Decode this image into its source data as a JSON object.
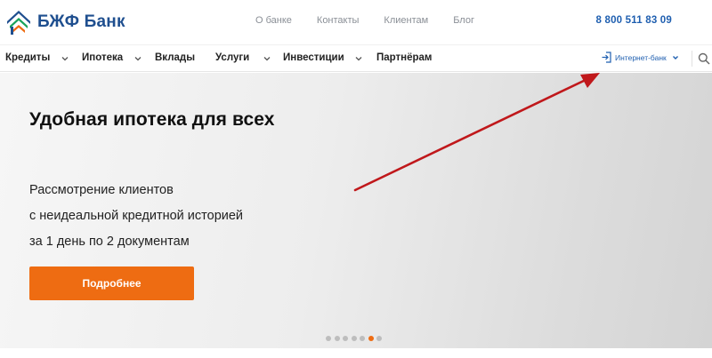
{
  "header": {
    "logo_text": "БЖФ Банк",
    "links": [
      "О банке",
      "Контакты",
      "Клиентам",
      "Блог"
    ],
    "phone": "8 800 511 83 09"
  },
  "nav": {
    "items": [
      "Кредиты",
      "Ипотека",
      "Вклады",
      "Услуги",
      "Инвестиции",
      "Партнёрам"
    ],
    "internet_bank": "Интернет-банк"
  },
  "hero": {
    "title": "Удобная ипотека для всех",
    "subtitle_lines": [
      "Рассмотрение клиентов",
      "с неидеальной кредитной историей",
      "за 1 день по 2 документам"
    ],
    "button_label": "Подробнее",
    "slides_total": 7,
    "active_slide": 6
  },
  "colors": {
    "brand_blue": "#1f4f8f",
    "link_blue": "#1f5fb0",
    "accent_orange": "#ee6c12",
    "arrow_red": "#c0181b"
  },
  "icons": [
    "logo-roof-icon",
    "login-icon",
    "chevron-down-icon",
    "search-icon"
  ]
}
